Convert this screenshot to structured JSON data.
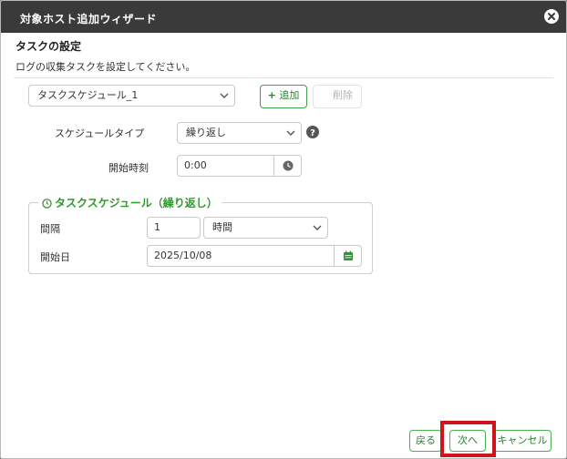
{
  "dialog": {
    "title": "対象ホスト追加ウィザード",
    "close_icon": "close-circle-icon"
  },
  "section": {
    "title": "タスクの設定",
    "description": "ログの収集タスクを設定してください。"
  },
  "task_toolbar": {
    "task_select_value": "タスクスケジュール_1",
    "add_label": "追加",
    "add_icon": "plus-icon",
    "delete_label": "削除"
  },
  "schedule_type": {
    "label": "スケジュールタイプ",
    "value": "繰り返し",
    "help_icon": "question-circle-icon"
  },
  "start_time": {
    "label": "開始時刻",
    "value": "0:00",
    "icon": "clock-icon"
  },
  "repeat_group": {
    "legend": "タスクスケジュール（繰り返し）",
    "legend_icon": "clock-icon",
    "interval_label": "間隔",
    "interval_value": "1",
    "interval_unit": "時間",
    "start_date_label": "開始日",
    "start_date_value": "2025/10/08",
    "calendar_icon": "calendar-icon"
  },
  "footer": {
    "back_label": "戻る",
    "next_label": "次へ",
    "cancel_label": "キャンセル"
  },
  "colors": {
    "titlebar": "#3a3a3a",
    "accent_green": "#2e9a2e",
    "highlight_red": "#d0141b"
  }
}
